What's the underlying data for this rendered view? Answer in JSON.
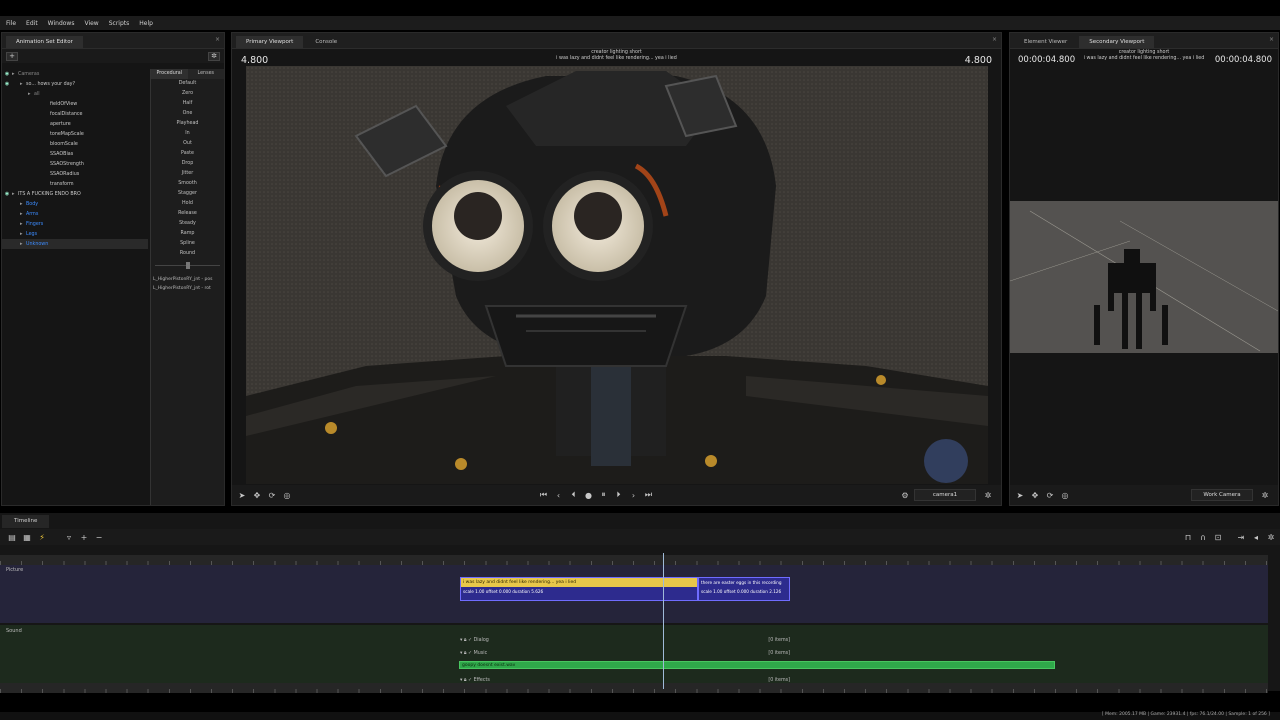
{
  "menu": [
    "File",
    "Edit",
    "Windows",
    "View",
    "Scripts",
    "Help"
  ],
  "ase": {
    "tab": "Animation Set Editor",
    "tree": [
      {
        "label": "Cameras",
        "depth": 0,
        "style": "dim"
      },
      {
        "label": "so... hows your day?",
        "depth": 1,
        "style": "normal"
      },
      {
        "label": "all",
        "depth": 2,
        "style": "dim"
      },
      {
        "label": "fieldOfView",
        "depth": 4,
        "style": "normal"
      },
      {
        "label": "focalDistance",
        "depth": 4,
        "style": "normal"
      },
      {
        "label": "aperture",
        "depth": 4,
        "style": "normal"
      },
      {
        "label": "toneMapScale",
        "depth": 4,
        "style": "normal"
      },
      {
        "label": "bloomScale",
        "depth": 4,
        "style": "normal"
      },
      {
        "label": "SSAOBias",
        "depth": 4,
        "style": "normal"
      },
      {
        "label": "SSAOStrength",
        "depth": 4,
        "style": "normal"
      },
      {
        "label": "SSAORadius",
        "depth": 4,
        "style": "normal"
      },
      {
        "label": "transform",
        "depth": 4,
        "style": "normal"
      },
      {
        "label": "ITS A FUCKING ENDO BRO",
        "depth": 0,
        "style": "normal"
      },
      {
        "label": "Body",
        "depth": 1,
        "style": "blue"
      },
      {
        "label": "Arms",
        "depth": 1,
        "style": "blue"
      },
      {
        "label": "Fingers",
        "depth": 1,
        "style": "blue"
      },
      {
        "label": "Legs",
        "depth": 1,
        "style": "blue"
      },
      {
        "label": "Unknown",
        "depth": 1,
        "style": "blue"
      }
    ],
    "proc_tabs": [
      "Procedural",
      "Lenses"
    ],
    "proc_buttons": [
      "Default",
      "Zero",
      "Half",
      "One",
      "Playhead",
      "In",
      "Out",
      "Paste",
      "Drop",
      "Jitter",
      "Smooth",
      "Stagger",
      "Hold",
      "Release",
      "Steady",
      "Ramp",
      "Spline",
      "Round"
    ],
    "slider_value": 0.5,
    "params": [
      "L_HigherPistonRY_jnt - pos",
      "L_HigherPistonRY_jnt - rot"
    ]
  },
  "primary": {
    "tabs": [
      "Primary Viewport",
      "Console"
    ],
    "title1": "creator lighting short",
    "title2": "i was lazy and didnt feel like rendering... yea i lied",
    "time_left": "4.800",
    "time_right": "4.800",
    "camera": "camera1"
  },
  "secondary": {
    "tabs": [
      "Element Viewer",
      "Secondary Viewport"
    ],
    "title1": "creator lighting short",
    "title2": "i was lazy and didnt feel like rendering... yea i lied",
    "time_left": "00:00:04.800",
    "time_right": "00:00:04.800",
    "camera": "Work Camera"
  },
  "timeline": {
    "tab": "Timeline",
    "picture_label": "Picture",
    "sound_label": "Sound",
    "clip1_title": "i was lazy and didnt feel like rendering... yea i lied",
    "clip1_info": "scale 1.00 offset 0.000 duration 5.626",
    "clip2_title": "there are easter eggs in this recording",
    "clip2_info": "scale 1.00 offset 0.000 duration 2.126",
    "sub_tracks": [
      {
        "name": "Dialog",
        "count": "[0 items]"
      },
      {
        "name": "Music",
        "count": "[0 items]"
      },
      {
        "name": "Effects",
        "count": "[0 items]"
      }
    ],
    "music_clip": "goopy doesnt exist.wav",
    "status": "[ Mem: 2005.17 MB | Game: 23931.4 | fps: 76.1/24.00 | Sample: 1 of 256 ]"
  }
}
